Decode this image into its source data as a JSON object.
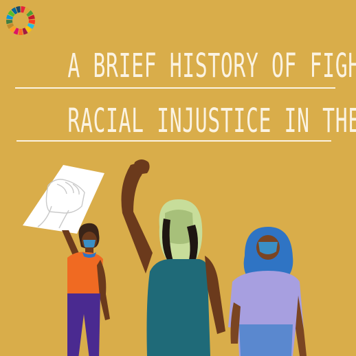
{
  "title": {
    "line1": "A brief history of fighting",
    "line2": "racial injustice in the US"
  },
  "colors": {
    "background": "#d9ad4a",
    "title_text": "#fbf3e2",
    "sign": "#ffffff",
    "skin_dark": "#6b3a1c",
    "skin_brown": "#7a4522",
    "shirt_orange": "#f06a22",
    "pants_purple": "#4a2a90",
    "tank_teal": "#1f6a78",
    "hijab_blue": "#2f74c4",
    "shirt_lavender": "#a79fe0",
    "mask_blue": "#3a8fc4"
  },
  "icons": {
    "logo": "sdg-color-wheel-icon",
    "sign_graphic": "raised-fist-icon"
  }
}
